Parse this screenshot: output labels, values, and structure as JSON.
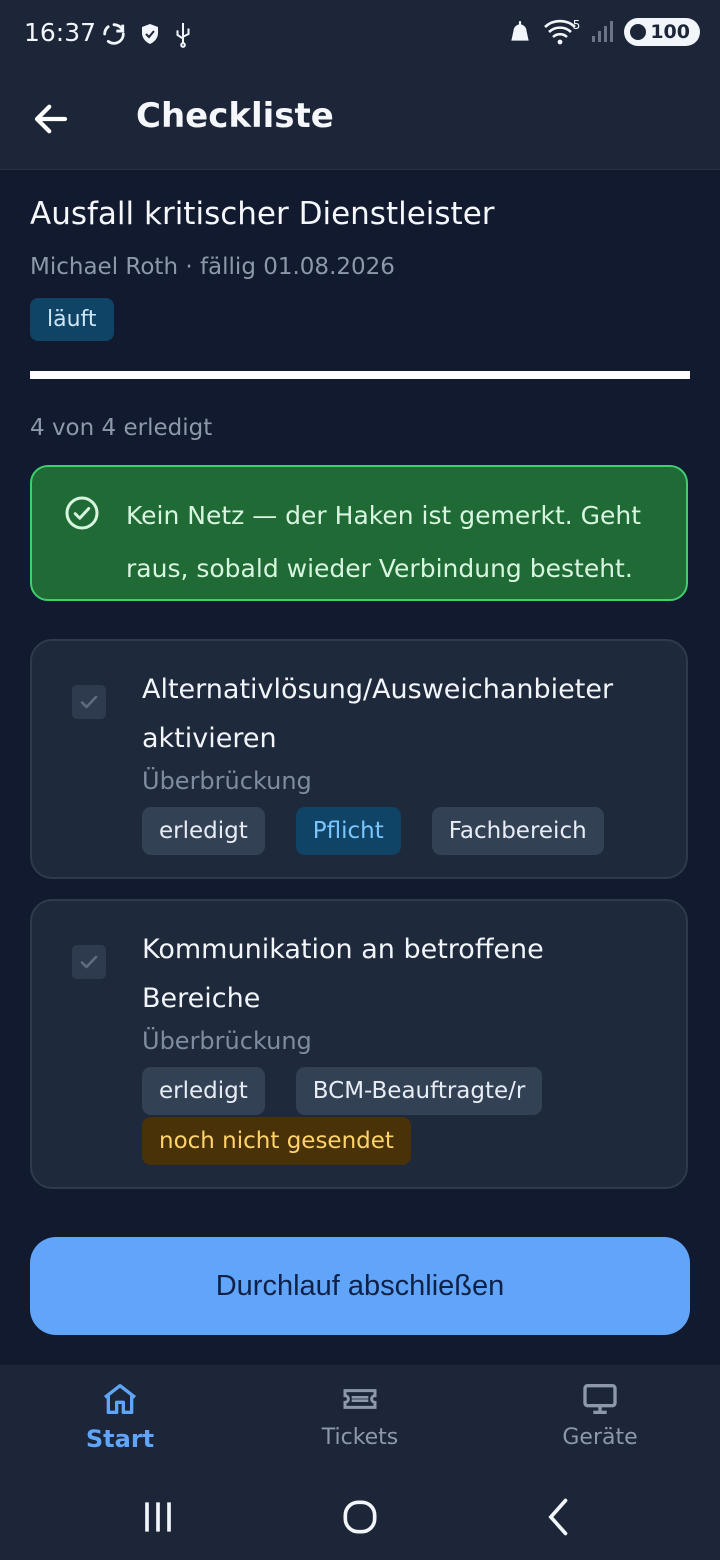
{
  "status_bar": {
    "time": "16:37",
    "battery": "100",
    "network_badge": "5",
    "icons": [
      "sync-icon",
      "shield-icon",
      "usb-icon",
      "alarm-icon",
      "wifi-icon",
      "signal-icon"
    ]
  },
  "app_bar": {
    "title": "Checkliste",
    "back_icon": "arrow-left-icon"
  },
  "checklist": {
    "title": "Ausfall kritischer Dienstleister",
    "meta": "Michael Roth · fällig 01.08.2026",
    "status": "läuft",
    "progress_fraction": 1.0,
    "progress_text": "4 von 4 erledigt"
  },
  "notice": {
    "icon": "check-circle-icon",
    "text": "Kein Netz — der Haken ist gemerkt. Geht raus, sobald wieder Verbindung besteht.",
    "colors": {
      "background": "#1f6a35",
      "border": "#3fcf6e"
    }
  },
  "tasks": [
    {
      "title": "Alternativlösung/Ausweichanbieter aktivieren",
      "category": "Überbrückung",
      "checked": true,
      "chips": [
        {
          "label": "erledigt",
          "kind": "neutral"
        },
        {
          "label": "Pflicht",
          "kind": "required"
        },
        {
          "label": "Fachbereich",
          "kind": "neutral"
        }
      ]
    },
    {
      "title": "Kommunikation an betroffene Bereiche",
      "category": "Überbrückung",
      "checked": true,
      "chips": [
        {
          "label": "erledigt",
          "kind": "neutral"
        },
        {
          "label": "BCM-Beauftragte/r",
          "kind": "neutral"
        },
        {
          "label": "noch nicht gesendet",
          "kind": "warn"
        }
      ]
    }
  ],
  "primary_action": {
    "label": "Durchlauf abschließen",
    "color": "#60a5fa"
  },
  "bottom_nav": [
    {
      "label": "Start",
      "icon": "home-icon",
      "active": true
    },
    {
      "label": "Tickets",
      "icon": "ticket-icon",
      "active": false
    },
    {
      "label": "Geräte",
      "icon": "monitor-icon",
      "active": false
    }
  ],
  "system_nav": [
    "recents-icon",
    "home-circle-icon",
    "back-chevron-icon"
  ]
}
